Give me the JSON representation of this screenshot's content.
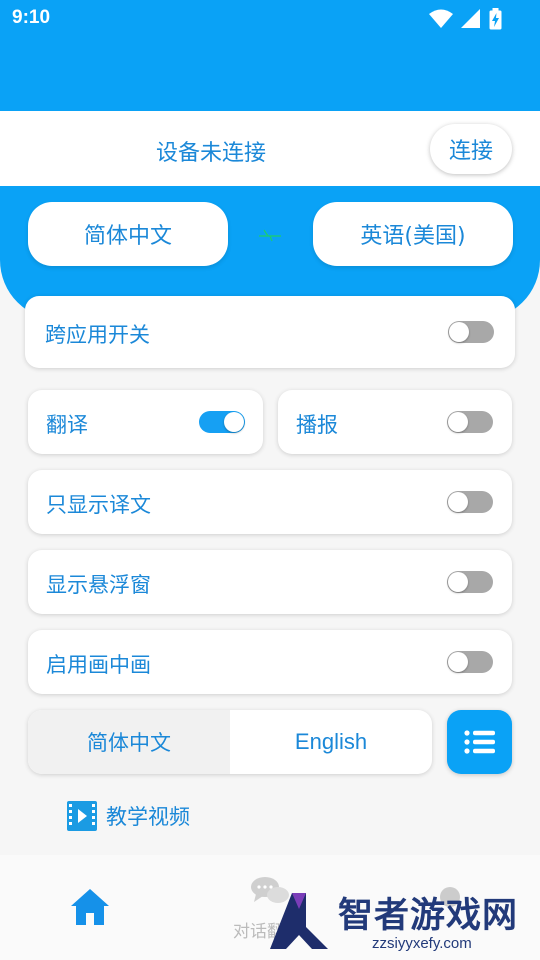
{
  "status_bar": {
    "time": "9:10",
    "icons": [
      "wifi-icon",
      "signal-icon",
      "battery-charging-icon"
    ]
  },
  "colors": {
    "primary": "#0aa2f6",
    "text_blue": "#1b88d8",
    "toggle_off": "#a8a8a8",
    "toggle_on": "#16a0f3"
  },
  "connection": {
    "status": "设备未连接",
    "button": "连接"
  },
  "languages": {
    "source": "简体中文",
    "target": "英语(美国)",
    "swap_icon": "arrow-swap-icon"
  },
  "toggles": [
    {
      "id": "cross-app",
      "label": "跨应用开关",
      "on": false
    },
    {
      "id": "translate",
      "label": "翻译",
      "on": true
    },
    {
      "id": "broadcast",
      "label": "播报",
      "on": false
    },
    {
      "id": "translation-only",
      "label": "只显示译文",
      "on": false
    },
    {
      "id": "floating-window",
      "label": "显示悬浮窗",
      "on": false
    },
    {
      "id": "picture-in-picture",
      "label": "启用画中画",
      "on": false
    }
  ],
  "ui_language": {
    "options": [
      "简体中文",
      "English"
    ],
    "selected": "简体中文",
    "menu_icon": "list-icon"
  },
  "tutorial": {
    "label": "教学视频",
    "icon": "video-icon"
  },
  "bottom_nav": {
    "items": [
      {
        "icon": "home-icon",
        "label": ""
      },
      {
        "icon": "chat-icon",
        "label": "对话翻"
      },
      {
        "icon": "profile-icon",
        "label": ""
      }
    ]
  },
  "watermark": {
    "title": "智者游戏网",
    "subtitle": "zzsiyyxefy.com"
  }
}
